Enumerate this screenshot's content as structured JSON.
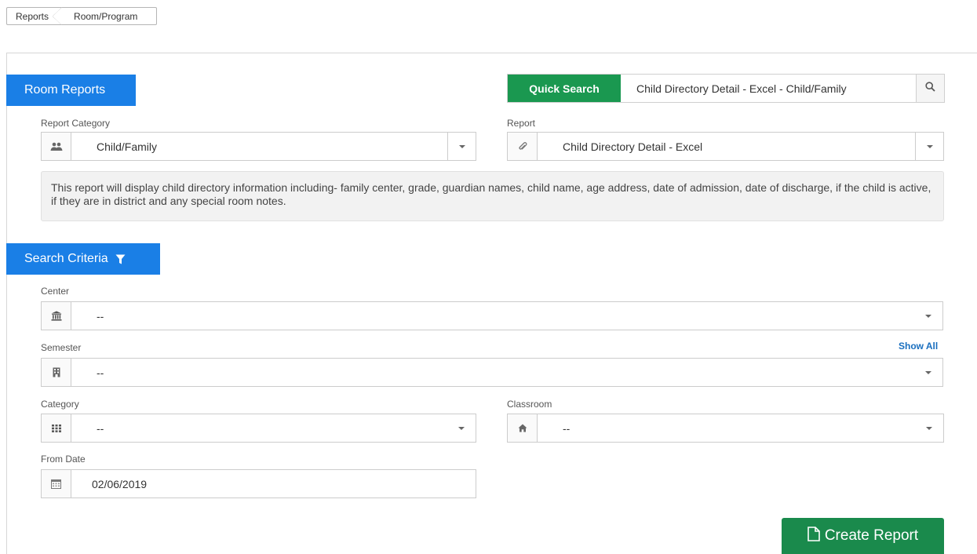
{
  "breadcrumb": {
    "items": [
      "Reports",
      "Room/Program"
    ]
  },
  "room_reports": {
    "title": "Room Reports"
  },
  "quick_search": {
    "label": "Quick Search",
    "value": "Child Directory Detail - Excel - Child/Family",
    "icon": "search-icon"
  },
  "report_category": {
    "label": "Report Category",
    "value": "Child/Family",
    "icon": "users-icon"
  },
  "report": {
    "label": "Report",
    "value": "Child Directory Detail - Excel",
    "icon": "paperclip-icon"
  },
  "description": "This report will display child directory information including- family center, grade, guardian names, child name, age address, date of admission, date of discharge, if the child is active, if they are in district and any special room notes.",
  "search_criteria": {
    "title": "Search Criteria",
    "icon": "filter-icon"
  },
  "center": {
    "label": "Center",
    "value": "--",
    "icon": "bank-icon"
  },
  "semester": {
    "label": "Semester",
    "value": "--",
    "show_all": "Show All",
    "icon": "calendar-book-icon"
  },
  "category": {
    "label": "Category",
    "value": "--",
    "icon": "grid-icon"
  },
  "classroom": {
    "label": "Classroom",
    "value": "--",
    "icon": "home-icon"
  },
  "from_date": {
    "label": "From Date",
    "value": "02/06/2019",
    "icon": "calendar-icon"
  },
  "create_report": {
    "label": "Create Report",
    "icon": "file-icon"
  },
  "colors": {
    "blue_tab": "#1a7fe6",
    "green": "#1a9850",
    "create_btn": "#1a8a4c",
    "link": "#1a6fbf"
  }
}
